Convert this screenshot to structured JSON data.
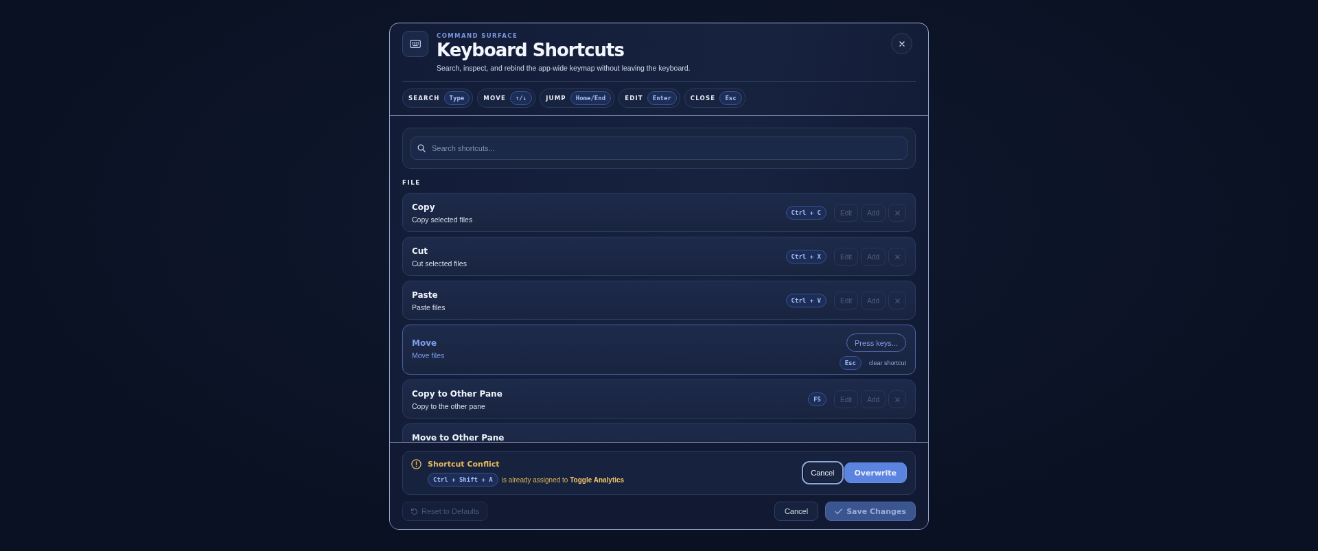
{
  "header": {
    "eyebrow": "COMMAND SURFACE",
    "title": "Keyboard Shortcuts",
    "subtitle": "Search, inspect, and rebind the app-wide keymap without leaving the keyboard."
  },
  "hints": [
    {
      "label": "SEARCH",
      "key": "Type"
    },
    {
      "label": "MOVE",
      "key": "↑/↓"
    },
    {
      "label": "JUMP",
      "key": "Home/End"
    },
    {
      "label": "EDIT",
      "key": "Enter"
    },
    {
      "label": "CLOSE",
      "key": "Esc"
    }
  ],
  "search": {
    "placeholder": "Search shortcuts..."
  },
  "groups": [
    {
      "title": "FILE",
      "shortcuts": [
        {
          "kind": "binding",
          "name": "Copy",
          "description": "Copy selected files",
          "key": "Ctrl + C",
          "actions": [
            {
              "label": "Edit",
              "disabled": true
            },
            {
              "label": "Add",
              "disabled": true
            }
          ]
        },
        {
          "kind": "binding",
          "name": "Cut",
          "description": "Cut selected files",
          "key": "Ctrl + X",
          "actions": [
            {
              "label": "Edit",
              "disabled": true
            },
            {
              "label": "Add",
              "disabled": true
            }
          ]
        },
        {
          "kind": "binding",
          "name": "Paste",
          "description": "Paste files",
          "key": "Ctrl + V",
          "actions": [
            {
              "label": "Edit",
              "disabled": true
            },
            {
              "label": "Add",
              "disabled": true
            }
          ]
        },
        {
          "kind": "recording",
          "name": "Move",
          "description": "Move files",
          "prompt": "Press keys...",
          "clear_key": "Esc",
          "clear_label": "clear shortcut"
        },
        {
          "kind": "binding",
          "name": "Copy to Other Pane",
          "description": "Copy to the other pane",
          "key": "F5",
          "actions": [
            {
              "label": "Edit",
              "disabled": true
            },
            {
              "label": "Add",
              "disabled": true
            }
          ]
        },
        {
          "kind": "binding",
          "name": "Move to Other Pane"
        }
      ]
    }
  ],
  "conflict": {
    "title": "Shortcut Conflict",
    "keys": "Ctrl + Shift + A",
    "message": "is already assigned to **Toggle Analytics**",
    "buttons": [
      {
        "label": "Cancel",
        "kind": "secondary",
        "focused": true
      },
      {
        "label": "Overwrite",
        "kind": "primary",
        "focused": false
      }
    ]
  },
  "footer": {
    "reset": {
      "label": "Reset to Defaults",
      "disabled": true
    },
    "cancel": "Cancel",
    "save": {
      "label": "Save Changes",
      "disabled": true
    }
  }
}
